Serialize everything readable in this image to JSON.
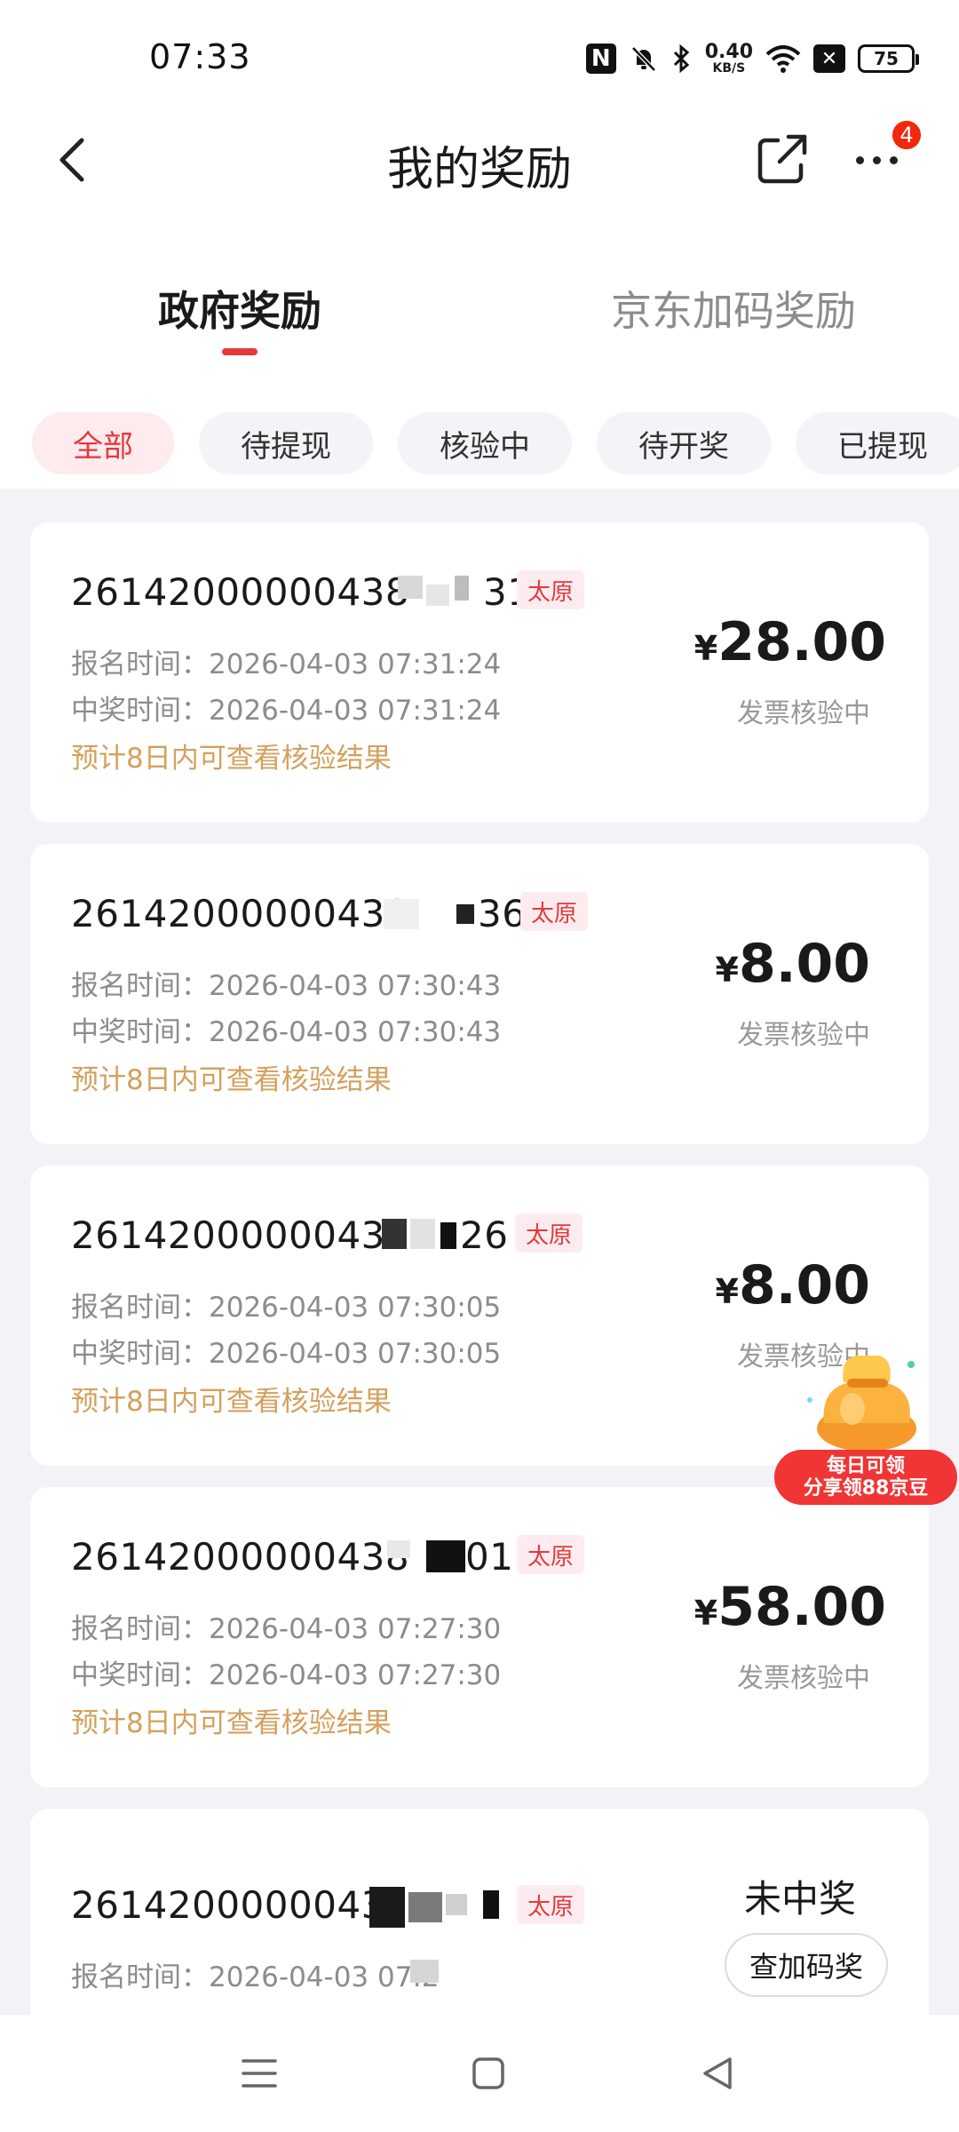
{
  "status_bar": {
    "time": "07:33",
    "nfc": "N",
    "net_speed_value": "0.40",
    "net_speed_unit": "KB/S",
    "battery": "75",
    "icons": [
      "nfc-icon",
      "mute-bell-icon",
      "bluetooth-icon",
      "wifi-icon",
      "notification-x-icon",
      "battery-icon"
    ]
  },
  "header": {
    "title": "我的奖励",
    "badge": "4"
  },
  "main_tabs": [
    {
      "label": "政府奖励",
      "active": true
    },
    {
      "label": "京东加码奖励",
      "active": false
    }
  ],
  "filters": [
    {
      "label": "全部",
      "active": true
    },
    {
      "label": "待提现",
      "active": false
    },
    {
      "label": "核验中",
      "active": false
    },
    {
      "label": "待开奖",
      "active": false
    },
    {
      "label": "已提现",
      "active": false
    }
  ],
  "records": [
    {
      "order_prefix": "26142000000438",
      "order_suffix": "31",
      "city": "太原",
      "signup_label": "报名时间：",
      "signup_time": "2026-04-03 07:31:24",
      "win_label": "中奖时间：",
      "win_time": "2026-04-03 07:31:24",
      "hint": "预计8日内可查看核验结果",
      "currency": "¥",
      "amount": "28.00",
      "status": "发票核验中"
    },
    {
      "order_prefix": "26142000000438",
      "order_suffix": "36",
      "city": "太原",
      "signup_label": "报名时间：",
      "signup_time": "2026-04-03 07:30:43",
      "win_label": "中奖时间：",
      "win_time": "2026-04-03 07:30:43",
      "hint": "预计8日内可查看核验结果",
      "currency": "¥",
      "amount": "8.00",
      "status": "发票核验中"
    },
    {
      "order_prefix": "26142000000438",
      "order_suffix": "26",
      "city": "太原",
      "signup_label": "报名时间：",
      "signup_time": "2026-04-03 07:30:05",
      "win_label": "中奖时间：",
      "win_time": "2026-04-03 07:30:05",
      "hint": "预计8日内可查看核验结果",
      "currency": "¥",
      "amount": "8.00",
      "status": "发票核验中"
    },
    {
      "order_prefix": "26142000000438",
      "order_suffix": "01",
      "city": "太原",
      "signup_label": "报名时间：",
      "signup_time": "2026-04-03 07:27:30",
      "win_label": "中奖时间：",
      "win_time": "2026-04-03 07:27:30",
      "hint": "预计8日内可查看核验结果",
      "currency": "¥",
      "amount": "58.00",
      "status": "发票核验中"
    },
    {
      "order_prefix": "2614200000043",
      "city": "太原",
      "signup_label": "报名时间：",
      "signup_time": "2026-04-03 07:2",
      "result": "未中奖",
      "action": "查加码奖"
    }
  ],
  "promo": {
    "line1": "每日可领",
    "line2": "分享领88京豆"
  },
  "colors": {
    "accent": "#e4393c",
    "hint": "#d4a05c",
    "page_bg": "#f2f2f7"
  }
}
